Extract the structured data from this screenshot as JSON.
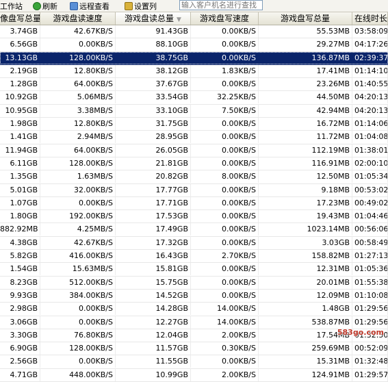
{
  "toolbar": {
    "item0_label": "工作站",
    "refresh_label": "刷新",
    "remote_label": "远程查看",
    "settings_label": "设置列",
    "search_placeholder": "输入客户机名进行查找"
  },
  "columns": [
    "像盘写总量",
    "游戏盘读速度",
    "游戏盘读总量",
    "游戏盘写速度",
    "游戏盘写总量",
    "在线时长"
  ],
  "sorted_column_index": 2,
  "selected_row_index": 2,
  "rows": [
    [
      "3.74GB",
      "42.67KB/S",
      "91.43GB",
      "0.00KB/S",
      "55.53MB",
      "03:58:09"
    ],
    [
      "6.56GB",
      "0.00KB/S",
      "88.10GB",
      "0.00KB/S",
      "29.27MB",
      "04:17:26"
    ],
    [
      "13.13GB",
      "128.00KB/S",
      "38.75GB",
      "0.00KB/S",
      "136.87MB",
      "02:39:37"
    ],
    [
      "2.19GB",
      "12.80KB/S",
      "38.12GB",
      "1.83KB/S",
      "17.41MB",
      "01:14:10"
    ],
    [
      "1.28GB",
      "64.00KB/S",
      "37.67GB",
      "0.00KB/S",
      "23.26MB",
      "01:40:55"
    ],
    [
      "10.92GB",
      "5.06MB/S",
      "33.54GB",
      "32.25KB/S",
      "44.50MB",
      "04:20:13"
    ],
    [
      "10.95GB",
      "3.38MB/S",
      "33.10GB",
      "7.50KB/S",
      "42.94MB",
      "04:20:13"
    ],
    [
      "1.98GB",
      "12.80KB/S",
      "31.75GB",
      "0.00KB/S",
      "16.72MB",
      "01:14:06"
    ],
    [
      "1.41GB",
      "2.94MB/S",
      "28.95GB",
      "0.00KB/S",
      "11.72MB",
      "01:04:08"
    ],
    [
      "11.94GB",
      "64.00KB/S",
      "26.05GB",
      "0.00KB/S",
      "112.19MB",
      "01:38:01"
    ],
    [
      "6.11GB",
      "128.00KB/S",
      "21.81GB",
      "0.00KB/S",
      "116.91MB",
      "02:00:10"
    ],
    [
      "1.35GB",
      "1.63MB/S",
      "20.82GB",
      "8.00KB/S",
      "12.50MB",
      "01:05:34"
    ],
    [
      "5.01GB",
      "32.00KB/S",
      "17.77GB",
      "0.00KB/S",
      "9.18MB",
      "00:53:02"
    ],
    [
      "1.07GB",
      "0.00KB/S",
      "17.71GB",
      "0.00KB/S",
      "17.23MB",
      "00:49:02"
    ],
    [
      "1.80GB",
      "192.00KB/S",
      "17.53GB",
      "0.00KB/S",
      "19.43MB",
      "01:04:46"
    ],
    [
      "882.92MB",
      "4.25MB/S",
      "17.49GB",
      "0.00KB/S",
      "1023.14MB",
      "00:56:06"
    ],
    [
      "4.38GB",
      "42.67KB/S",
      "17.32GB",
      "0.00KB/S",
      "3.03GB",
      "00:58:49"
    ],
    [
      "5.82GB",
      "416.00KB/S",
      "16.43GB",
      "2.70KB/S",
      "158.82MB",
      "01:27:13"
    ],
    [
      "1.54GB",
      "15.63MB/S",
      "15.81GB",
      "0.00KB/S",
      "12.31MB",
      "01:05:36"
    ],
    [
      "8.23GB",
      "512.00KB/S",
      "15.75GB",
      "0.00KB/S",
      "20.01MB",
      "01:55:38"
    ],
    [
      "9.93GB",
      "384.00KB/S",
      "14.52GB",
      "0.00KB/S",
      "12.09MB",
      "01:10:08"
    ],
    [
      "2.98GB",
      "0.00KB/S",
      "14.28GB",
      "14.00KB/S",
      "1.48GB",
      "01:29:56"
    ],
    [
      "3.06GB",
      "0.00KB/S",
      "12.27GB",
      "14.00KB/S",
      "538.87MB",
      "01:29:56"
    ],
    [
      "3.30GB",
      "76.80KB/S",
      "12.04GB",
      "2.00KB/S",
      "17.54MB",
      "01:32:50"
    ],
    [
      "6.90GB",
      "128.00KB/S",
      "11.57GB",
      "0.30KB/S",
      "259.69MB",
      "00:52:09"
    ],
    [
      "2.56GB",
      "0.00KB/S",
      "11.55GB",
      "0.00KB/S",
      "15.31MB",
      "01:32:48"
    ],
    [
      "4.71GB",
      "448.00KB/S",
      "10.99GB",
      "2.00KB/S",
      "124.91MB",
      "01:29:57"
    ]
  ],
  "watermark": "583go.com",
  "colors": {
    "selection": "#0a246a",
    "header_bg": "#ebeadb",
    "toolbar_bg": "#f4f3ee"
  }
}
